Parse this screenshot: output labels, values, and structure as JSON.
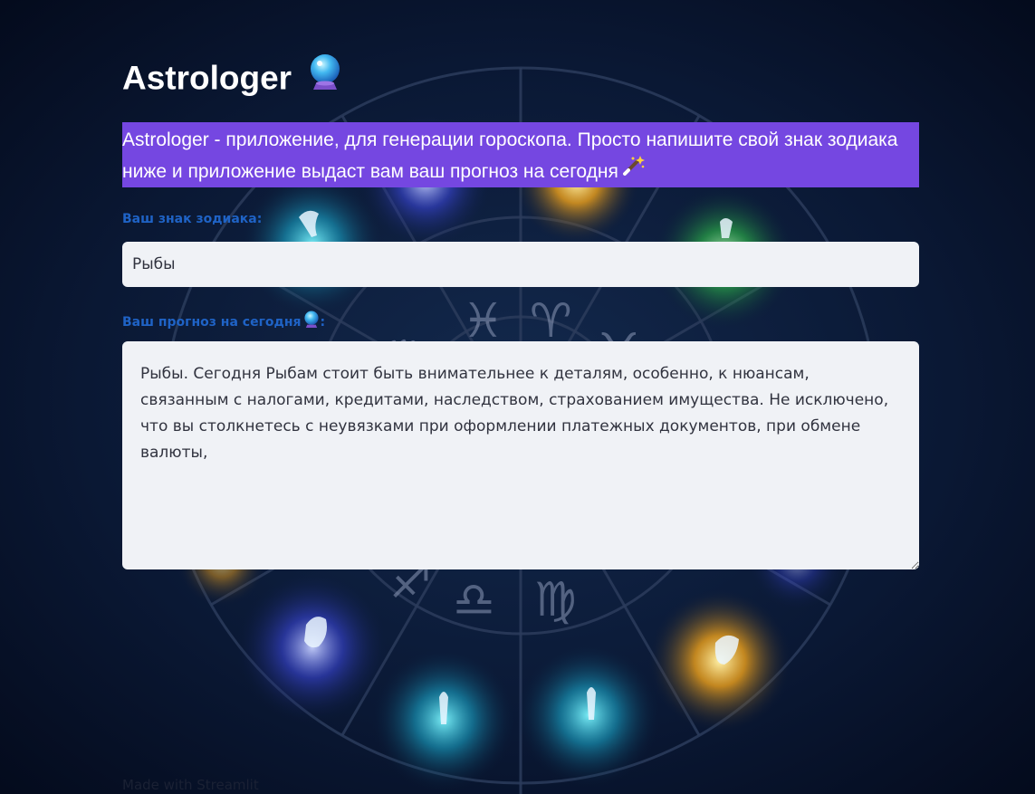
{
  "app": {
    "title": "Astrologer",
    "title_icon": "crystal-ball-icon",
    "intro_text": "Astrologer - приложение, для генерации гороскопа. Просто напишите свой знак зодиака ниже и приложение выдаст вам ваш прогноз на сегодня",
    "intro_icon": "magic-wand-icon",
    "accent_color": "#7547e1",
    "label_color": "#1f63c6"
  },
  "form": {
    "sign_label": "Ваш знак зодиака:",
    "sign_value": "Рыбы",
    "forecast_label": "Ваш прогноз на сегодня",
    "forecast_label_suffix": ":",
    "forecast_label_icon": "crystal-ball-icon",
    "forecast_value": "Рыбы. Сегодня Рыбам стоит быть внимательнее к деталям, особенно, к нюансам, связанным с налогами, кредитами, наследством, страхованием имущества. Не исключено, что вы столкнетесь с неувязками при оформлении платежных документов, при обмене валюты,"
  },
  "footer": {
    "text": "Made with Streamlit"
  },
  "background": {
    "description_icon": "zodiac-wheel-background"
  }
}
